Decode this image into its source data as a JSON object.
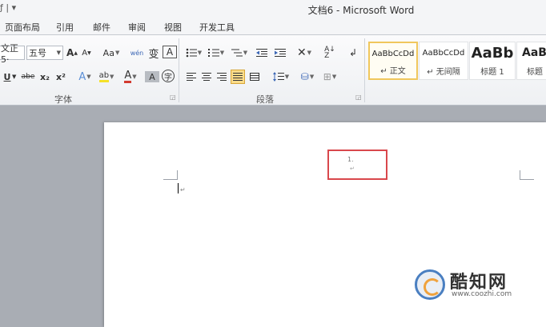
{
  "titlebar": {
    "qat": "ƒ | ▾",
    "title": "文档6 - Microsoft Word"
  },
  "tabs": [
    "页面布局",
    "引用",
    "邮件",
    "审阅",
    "视图",
    "开发工具"
  ],
  "font_group": {
    "font_name": "文正5·",
    "font_size": "五号",
    "grow_font": "A",
    "shrink_font": "A",
    "change_case": "Aa",
    "phonetic": "wén",
    "char_border": "A",
    "enclose": "变",
    "underline": "U",
    "strikethrough": "abe",
    "subscript": "x₂",
    "superscript": "x²",
    "text_effect": "A",
    "highlight": "ab",
    "font_color": "A",
    "char_shading": "A",
    "enclose_char": "字",
    "label": "字体"
  },
  "paragraph_group": {
    "label": "段落"
  },
  "styles": [
    {
      "sample": "AaBbCcDd",
      "name": "↵ 正文"
    },
    {
      "sample": "AaBbCcDd",
      "name": "↵ 无间隔"
    },
    {
      "sample": "AaBb",
      "name": "标题 1"
    },
    {
      "sample": "AaB",
      "name": "标题"
    }
  ],
  "document": {
    "header_number": "1.",
    "header_mark": "↵",
    "para_mark": "↵"
  },
  "watermark": {
    "brand": "酷知网",
    "url": "www.coozhi.com"
  },
  "colors": {
    "highlight_box": "#d9474c",
    "selected_style": "#f0c75c",
    "font_color_red": "#d23a2f",
    "highlight_yellow": "#f5e12a"
  }
}
